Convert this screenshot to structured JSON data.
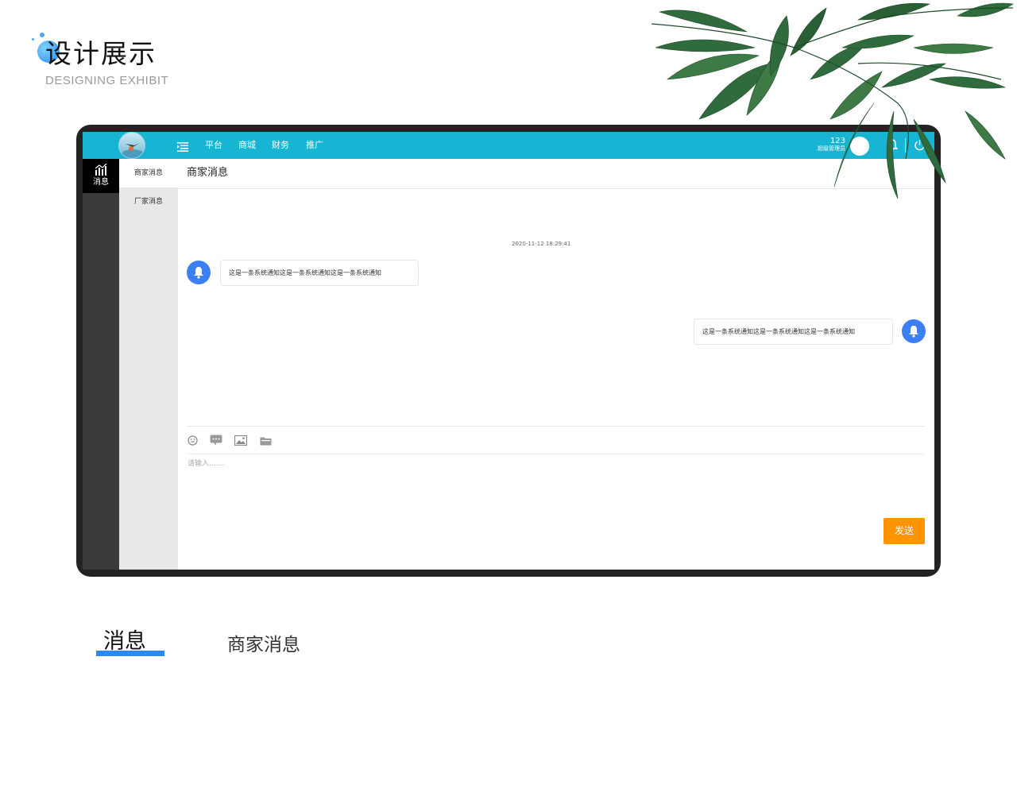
{
  "page": {
    "title": "设计展示",
    "subtitle": "DESIGNING EXHIBIT"
  },
  "app": {
    "topbar": {
      "nav": [
        "平台",
        "商城",
        "财务",
        "推广"
      ],
      "user_number": "123",
      "user_role": "超级管理员",
      "color": "#17b4d4"
    },
    "sidebar": {
      "active_item": {
        "label": "消息",
        "icon": "chart-icon"
      },
      "sub_items": [
        {
          "label": "商家消息",
          "active": true
        },
        {
          "label": "厂家消息",
          "active": false
        }
      ]
    },
    "content": {
      "title": "商家消息",
      "timestamp": "2020-11-12 18:29:41",
      "messages": [
        {
          "side": "left",
          "text": "这是一条系统通知这是一条系统通知这是一条系统通知",
          "icon": "bell-icon"
        },
        {
          "side": "right",
          "text": "这是一条系统通知这是一条系统通知这是一条系统通知",
          "icon": "bell-icon"
        }
      ],
      "toolbar_icons": [
        "emoji-icon",
        "chat-icon",
        "image-icon",
        "folder-icon"
      ],
      "input_placeholder": "请输入.......",
      "send_label": "发送",
      "send_color": "#ff9400"
    }
  },
  "labels": {
    "section": "消息",
    "subsection": "商家消息"
  }
}
